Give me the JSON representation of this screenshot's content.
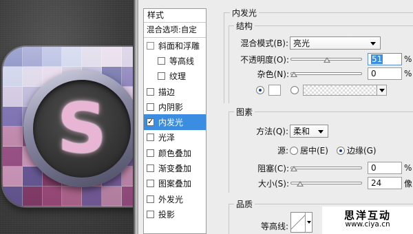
{
  "canvas": {
    "icon_letter": "S"
  },
  "styles_list": {
    "header": "样式",
    "blending_options": "混合选项:自定",
    "items": [
      {
        "label": "斜面和浮雕",
        "checked": false,
        "sub": false,
        "selected": false
      },
      {
        "label": "等高线",
        "checked": false,
        "sub": true,
        "selected": false
      },
      {
        "label": "纹理",
        "checked": false,
        "sub": true,
        "selected": false
      },
      {
        "label": "描边",
        "checked": false,
        "sub": false,
        "selected": false
      },
      {
        "label": "内阴影",
        "checked": false,
        "sub": false,
        "selected": false
      },
      {
        "label": "内发光",
        "checked": true,
        "sub": false,
        "selected": true
      },
      {
        "label": "光泽",
        "checked": false,
        "sub": false,
        "selected": false
      },
      {
        "label": "颜色叠加",
        "checked": false,
        "sub": false,
        "selected": false
      },
      {
        "label": "渐变叠加",
        "checked": false,
        "sub": false,
        "selected": false
      },
      {
        "label": "图案叠加",
        "checked": false,
        "sub": false,
        "selected": false
      },
      {
        "label": "外发光",
        "checked": false,
        "sub": false,
        "selected": false
      },
      {
        "label": "投影",
        "checked": false,
        "sub": false,
        "selected": false
      }
    ]
  },
  "panel": {
    "title": "内发光",
    "structure": {
      "legend": "结构",
      "blend_mode_label": "混合模式(B):",
      "blend_mode_value": "亮光",
      "opacity_label": "不透明度(O):",
      "opacity_value": "51",
      "opacity_fraction": 0.51,
      "noise_label": "杂色(N):",
      "noise_value": "0",
      "noise_fraction": 0.0,
      "percent": "%"
    },
    "elements": {
      "legend": "图素",
      "method_label": "方法(Q):",
      "method_value": "柔和",
      "source_label": "源:",
      "source_center": "居中(E)",
      "source_edge": "边缘(G)",
      "choke_label": "阻塞(C):",
      "choke_value": "0",
      "choke_fraction": 0.0,
      "size_label": "大小(S):",
      "size_value": "24",
      "size_fraction": 0.1,
      "percent": "%",
      "pixel_unit": "像"
    },
    "quality": {
      "legend": "品质",
      "contour_label": "等高线:"
    }
  },
  "watermark": {
    "name": "思洋互动",
    "url": "www.ciya.cn"
  },
  "colors": {
    "selection": "#3a8de0",
    "dialog_bg": "#ececec"
  }
}
